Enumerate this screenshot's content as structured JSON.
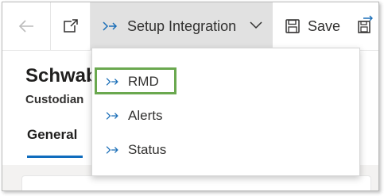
{
  "commandbar": {
    "setup_label": "Setup Integration",
    "save_label": "Save"
  },
  "record": {
    "title": "Schwab",
    "subtitle": "Custodian",
    "tab_general": "General"
  },
  "menu": {
    "items": [
      {
        "label": "RMD",
        "icon": "flow-icon",
        "highlighted": true
      },
      {
        "label": "Alerts",
        "icon": "flow-icon"
      },
      {
        "label": "Status",
        "icon": "flow-icon"
      }
    ],
    "highlight_color": "#6aa84f"
  },
  "colors": {
    "accent": "#0f6cbd",
    "flow_icon": "#1c6fb8",
    "active_button_bg": "#e1e1e1"
  }
}
